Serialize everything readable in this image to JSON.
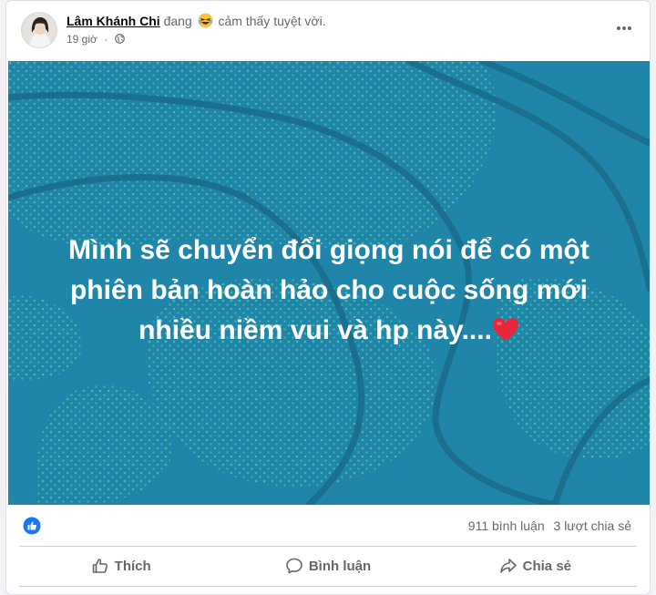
{
  "post": {
    "author": "Lâm Khánh Chi",
    "feeling_verb": "đang",
    "feeling_emoji": "laughing-face-icon",
    "feeling": "cảm thấy tuyệt vời.",
    "time": "19 giờ",
    "dot": "·",
    "audience_icon": "globe-icon",
    "more_icon": "more-options-icon",
    "text": "Mình sẽ chuyển đổi giọng nói để có một phiên bản hoàn hảo cho cuộc sống mới nhiều niềm vui và hp này....",
    "text_emoji": "red-heart-icon",
    "background_color": "#1f86aa",
    "dot_color": "#43b8a5"
  },
  "stats": {
    "reaction_icon": "like-reaction-icon",
    "comments": "911 bình luận",
    "shares": "3 lượt chia sẻ"
  },
  "actions": {
    "like": "Thích",
    "comment": "Bình luận",
    "share": "Chia sẻ"
  }
}
